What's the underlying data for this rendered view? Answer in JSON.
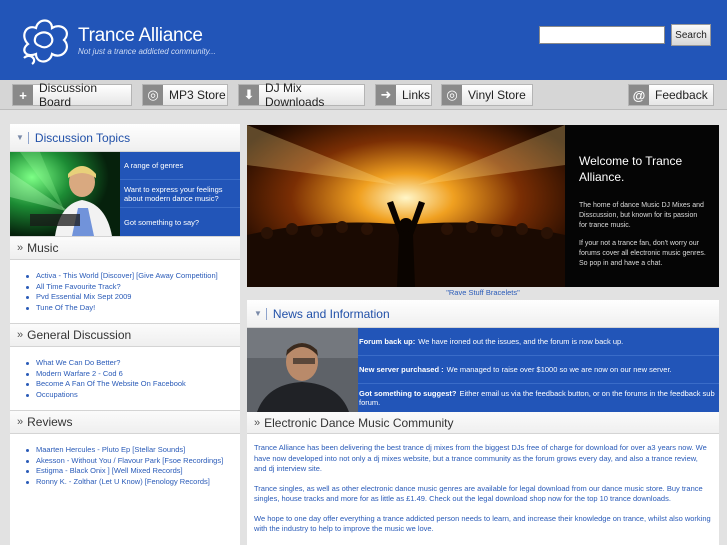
{
  "header": {
    "title": "Trance Alliance",
    "tagline": "Not just a trance addicted community...",
    "search_button": "Search",
    "search_value": ""
  },
  "nav": {
    "items": [
      {
        "label": "Discussion Board",
        "icon": "plus-icon"
      },
      {
        "label": "MP3 Store",
        "icon": "disc-icon"
      },
      {
        "label": "DJ Mix Downloads",
        "icon": "download-arrow-icon"
      },
      {
        "label": "Links",
        "icon": "right-arrow-icon"
      },
      {
        "label": "Vinyl Store",
        "icon": "disc-icon"
      }
    ],
    "feedback": {
      "label": "Feedback",
      "icon": "at-icon"
    }
  },
  "sidebar": {
    "topics_title": "Discussion Topics",
    "topics": [
      "A range of genres",
      "Want to express your feelings about modern dance music?",
      "Got something to say?"
    ],
    "sections": [
      {
        "title": "Music",
        "items": [
          "Activa - This World [Discover] [Give Away Competition]",
          "All Time Favourite Track?",
          "Pvd Essential Mix Sept 2009",
          "Tune Of The Day!"
        ]
      },
      {
        "title": "General Discussion",
        "items": [
          "What We Can Do Better?",
          "Modern Warfare 2 - Cod 6",
          "Become A Fan Of The Website On Facebook",
          "Occupations"
        ]
      },
      {
        "title": "Reviews",
        "items": [
          "Maarten Hercules - Pluto Ep [Stellar Sounds]",
          "Akesson - Without You / Flavour Park [Fsoe Recordings]",
          "Estigma - Black Onix ] [Well Mixed Records]",
          "Ronny K. - Zolthar (Let U Know) [Fenology Records]"
        ]
      }
    ]
  },
  "hero": {
    "title": "Welcome to Trance Alliance.",
    "p1": "The home of dance Music DJ Mixes and Disscussion, but known for its passion for trance music.",
    "p2": "If your not a trance fan, don't worry our forums cover all electronic music genres. So pop in and have a chat.",
    "caption": "\"Rave Stuff Bracelets\""
  },
  "news": {
    "title": "News and Information",
    "items": [
      {
        "bold": "Forum back up:",
        "text": "We have ironed out the issues, and the forum is now back up."
      },
      {
        "bold": "New server purchased :",
        "text": "We managed to raise over $1000 so we are now on our new server."
      },
      {
        "bold": "Got something to suggest?",
        "text": "Either email us via the feedback button, or on the forums in the feedback sub forum."
      }
    ]
  },
  "edm": {
    "title": "Electronic Dance Music Community",
    "paragraphs": [
      "Trance Alliance has been delivering the best trance dj mixes from the biggest DJs free of charge for download for over a3 years now. We have now developed into not only a dj mixes website, but a trance community as the forum grows every day, and also a trance review, and dj interview site.",
      "Trance singles, as well as other electronic dance music genres are available for legal download from our dance music store. Buy trance singles, house tracks and more for as little as £1.49. Check out the legal download shop now for the top 10 trance downloads.",
      "We hope to one day offer everything a trance addicted person needs to learn, and increase their knowledge on trance, whilst also working with the industry to help to improve the music we love."
    ]
  },
  "colors": {
    "brand_blue": "#2255b8",
    "link_blue": "#2a5bb8",
    "nav_bg": "#d6d6d6"
  }
}
